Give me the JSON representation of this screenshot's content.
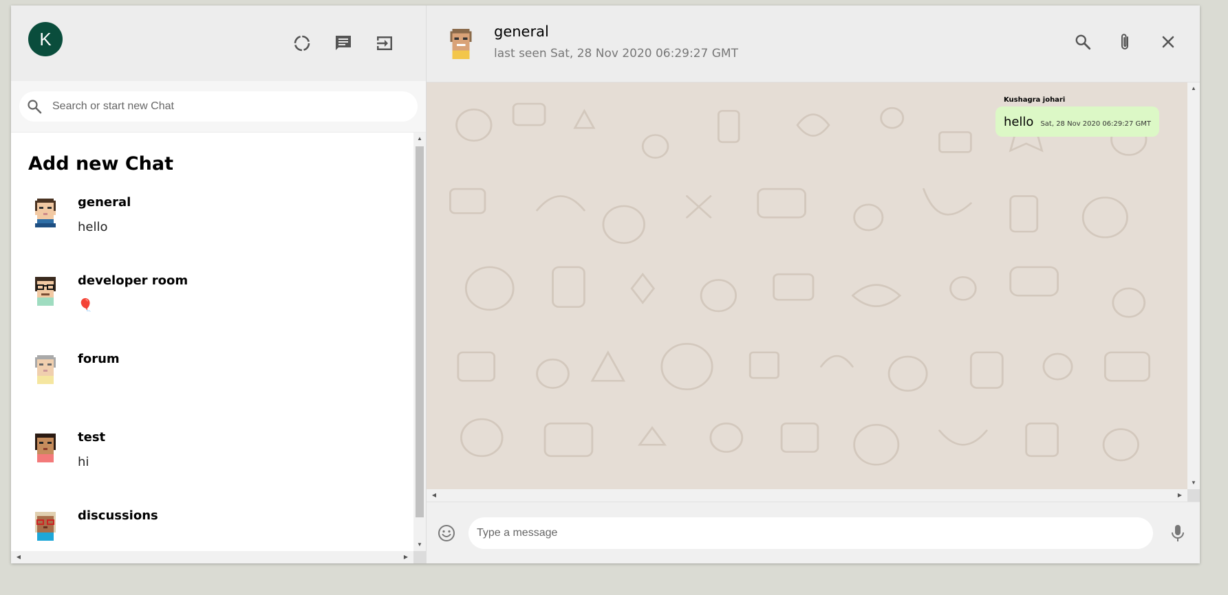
{
  "user": {
    "initial": "K",
    "avatar_color": "#0a4d3c"
  },
  "sidebar": {
    "icons": [
      "status-icon",
      "new-chat-icon",
      "logout-icon"
    ],
    "search": {
      "placeholder": "Search or start new Chat",
      "value": ""
    },
    "add_new_chat": "Add new Chat",
    "chats": [
      {
        "name": "general",
        "last": "hello",
        "avatar": "avatar-general"
      },
      {
        "name": "developer room",
        "last": "🎈",
        "avatar": "avatar-developer-room"
      },
      {
        "name": "forum",
        "last": "",
        "avatar": "avatar-forum"
      },
      {
        "name": "test",
        "last": "hi",
        "avatar": "avatar-test"
      },
      {
        "name": "discussions",
        "last": "",
        "avatar": "avatar-discussions"
      }
    ]
  },
  "chat": {
    "name": "general",
    "last_seen": "last seen Sat, 28 Nov 2020 06:29:27 GMT",
    "icons": [
      "search-icon",
      "attach-icon",
      "close-icon"
    ],
    "messages": [
      {
        "sender": "Kushagra johari",
        "text": "hello",
        "time": "Sat, 28 Nov 2020 06:29:27 GMT"
      }
    ]
  },
  "composer": {
    "placeholder": "Type a message",
    "value": ""
  },
  "colors": {
    "bubble": "#dcf8c6",
    "wallpaper": "#e5ddd5",
    "header": "#ededed"
  }
}
